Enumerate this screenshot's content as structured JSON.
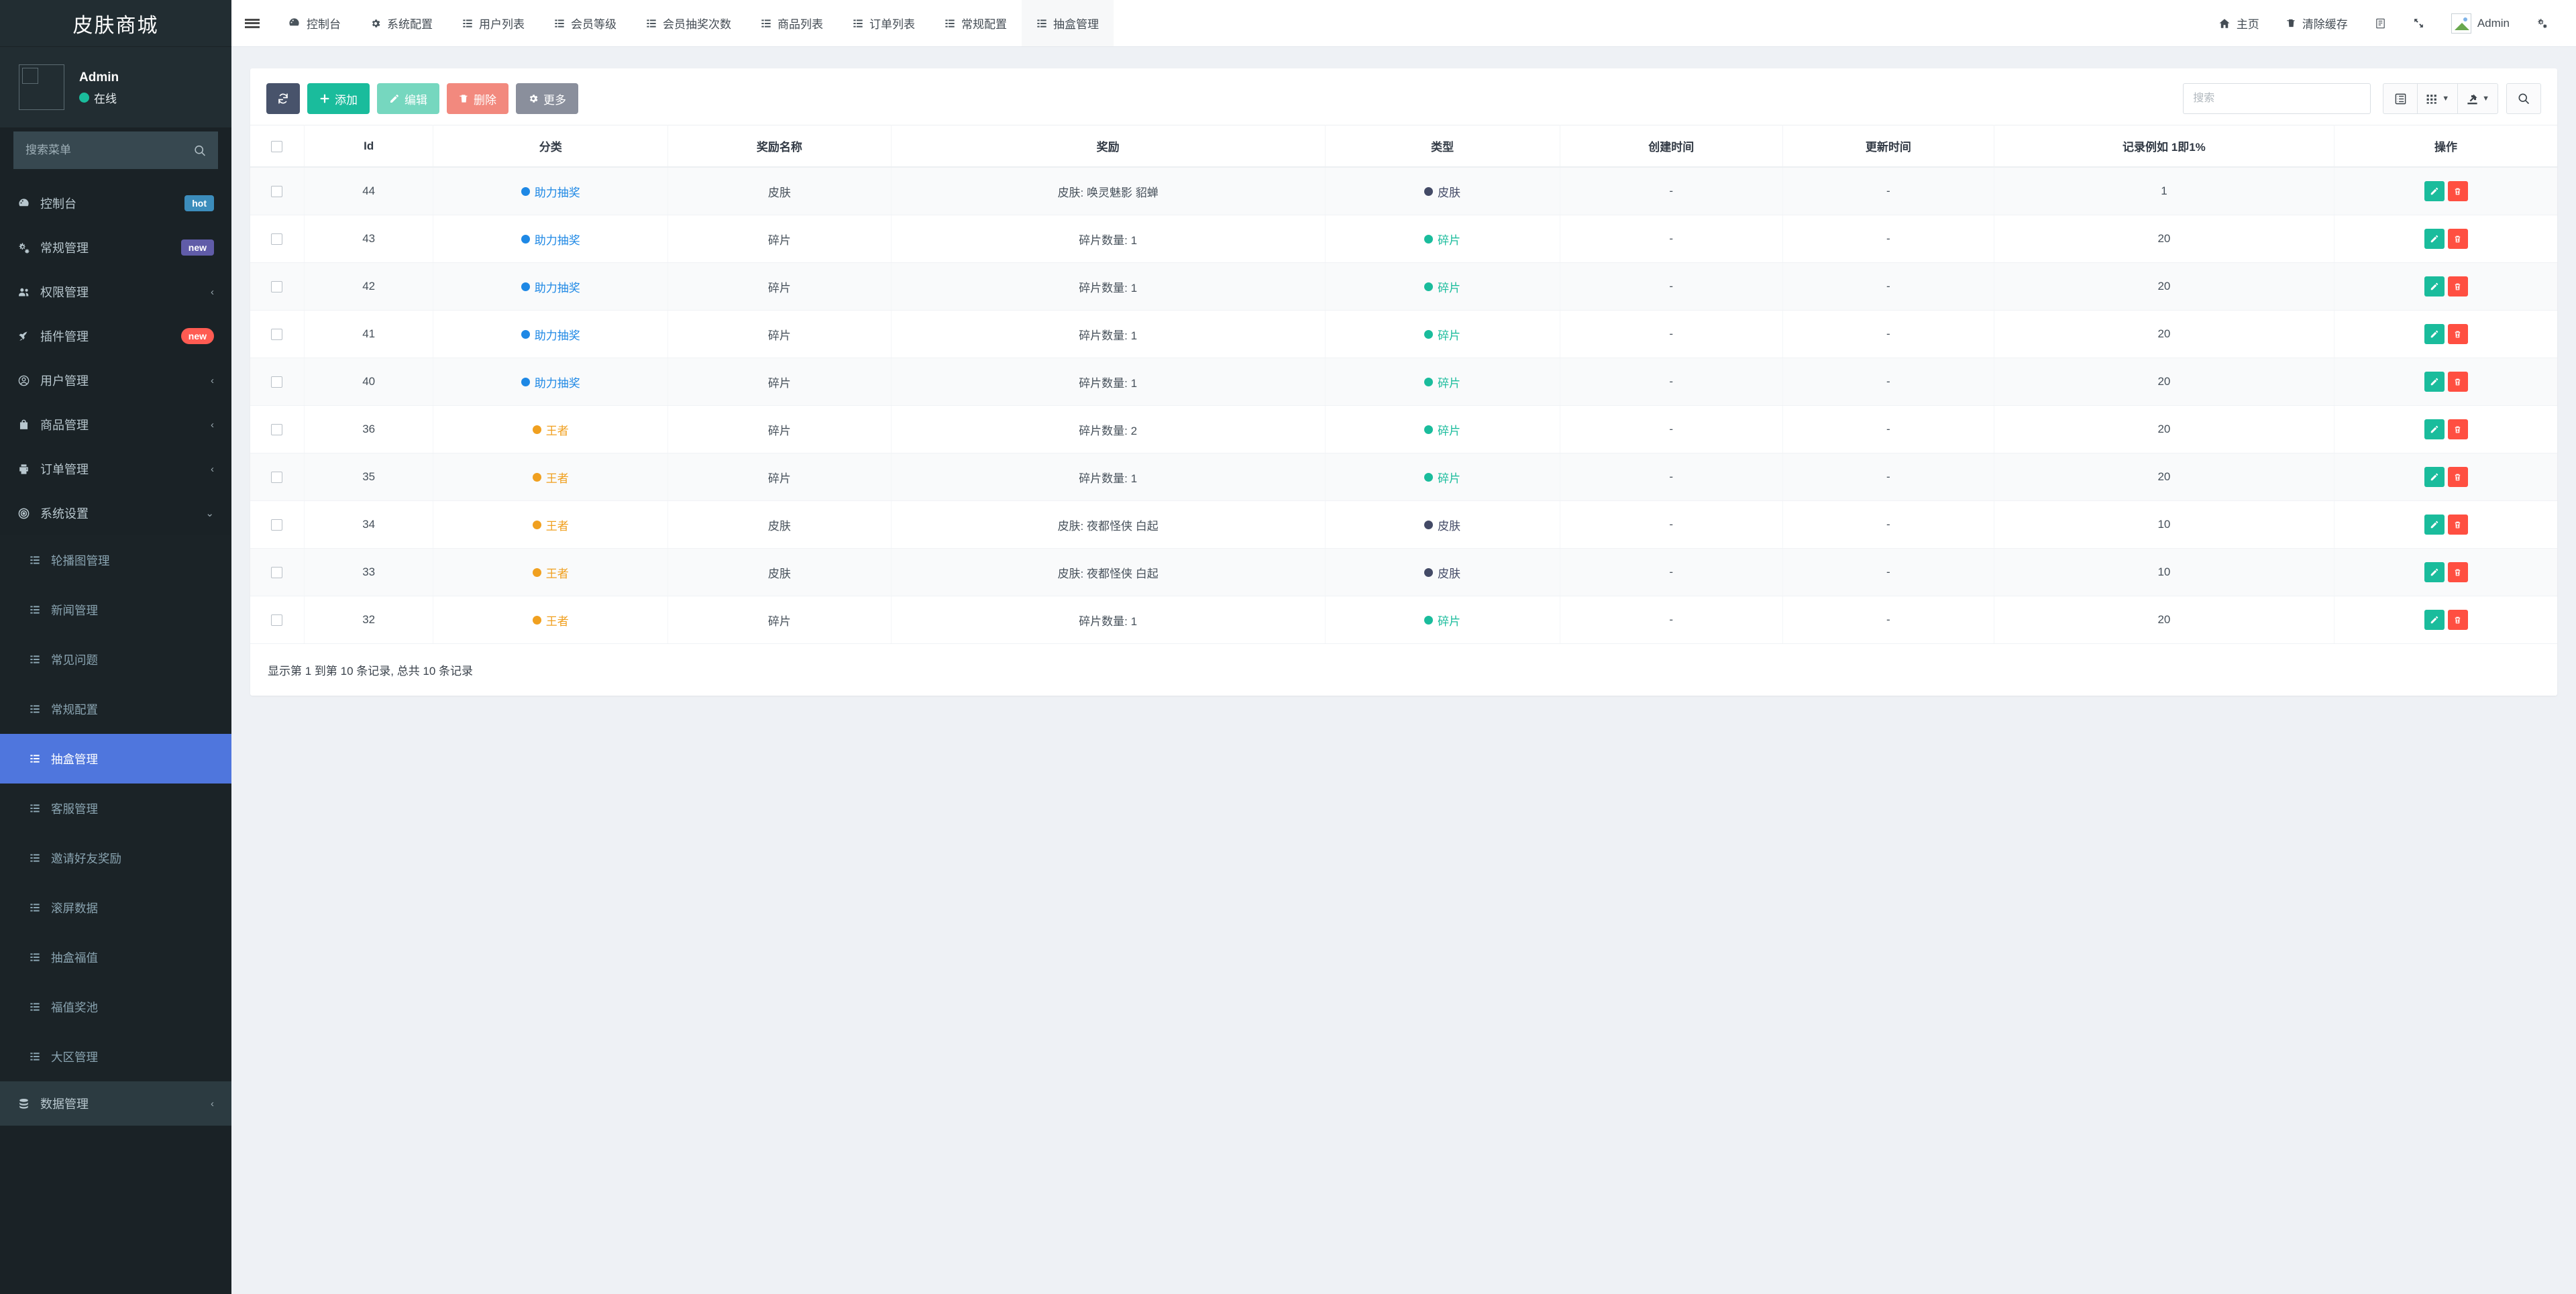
{
  "sidebar": {
    "brand": "皮肤商城",
    "user": {
      "name": "Admin",
      "status": "在线"
    },
    "search_placeholder": "搜索菜单",
    "menu": [
      {
        "label": "控制台",
        "icon": "dashboard-icon",
        "badge": "hot",
        "badge_style": "hot",
        "arrow": ""
      },
      {
        "label": "常规管理",
        "icon": "cogs-icon",
        "badge": "new",
        "badge_style": "new-purple",
        "arrow": ""
      },
      {
        "label": "权限管理",
        "icon": "users-icon",
        "badge": "",
        "badge_style": "",
        "arrow": "‹"
      },
      {
        "label": "插件管理",
        "icon": "rocket-icon",
        "badge": "new",
        "badge_style": "new-red",
        "arrow": ""
      },
      {
        "label": "用户管理",
        "icon": "user-circle-icon",
        "badge": "",
        "badge_style": "",
        "arrow": "‹"
      },
      {
        "label": "商品管理",
        "icon": "bag-icon",
        "badge": "",
        "badge_style": "",
        "arrow": "‹"
      },
      {
        "label": "订单管理",
        "icon": "printer-icon",
        "badge": "",
        "badge_style": "",
        "arrow": "‹"
      },
      {
        "label": "系统设置",
        "icon": "target-icon",
        "badge": "",
        "badge_style": "",
        "arrow": "⌄"
      }
    ],
    "submenu": [
      {
        "label": "轮播图管理",
        "active": false
      },
      {
        "label": "新闻管理",
        "active": false
      },
      {
        "label": "常见问题",
        "active": false
      },
      {
        "label": "常规配置",
        "active": false
      },
      {
        "label": "抽盒管理",
        "active": true
      },
      {
        "label": "客服管理",
        "active": false
      },
      {
        "label": "邀请好友奖励",
        "active": false
      },
      {
        "label": "滚屏数据",
        "active": false
      },
      {
        "label": "抽盒福值",
        "active": false
      },
      {
        "label": "福值奖池",
        "active": false
      },
      {
        "label": "大区管理",
        "active": false
      }
    ],
    "footer_menu": {
      "label": "数据管理",
      "icon": "database-icon",
      "arrow": "‹"
    }
  },
  "header": {
    "tabs": [
      {
        "label": "控制台",
        "icon": "dashboard-icon",
        "active": false
      },
      {
        "label": "系统配置",
        "icon": "gear-icon",
        "active": false
      },
      {
        "label": "用户列表",
        "icon": "list-icon",
        "active": false
      },
      {
        "label": "会员等级",
        "icon": "list-icon",
        "active": false
      },
      {
        "label": "会员抽奖次数",
        "icon": "list-icon",
        "active": false
      },
      {
        "label": "商品列表",
        "icon": "list-icon",
        "active": false
      },
      {
        "label": "订单列表",
        "icon": "list-icon",
        "active": false
      },
      {
        "label": "常规配置",
        "icon": "list-icon",
        "active": false
      },
      {
        "label": "抽盒管理",
        "icon": "list-icon",
        "active": true
      }
    ],
    "right": [
      {
        "label": "主页",
        "icon": "home-icon"
      },
      {
        "label": "清除缓存",
        "icon": "trash-icon"
      },
      {
        "label": "",
        "icon": "language-icon"
      },
      {
        "label": "",
        "icon": "fullscreen-icon"
      },
      {
        "label": "Admin",
        "icon": "avatar-icon"
      },
      {
        "label": "",
        "icon": "settings-gear-icon"
      }
    ]
  },
  "toolbar": {
    "refresh_label": "",
    "add_label": "添加",
    "edit_label": "编辑",
    "delete_label": "删除",
    "more_label": "更多",
    "search_placeholder": "搜索",
    "tool_buttons": [
      {
        "icon": "columns-icon",
        "caret": false
      },
      {
        "icon": "grid-icon",
        "caret": true
      },
      {
        "icon": "export-icon",
        "caret": true
      }
    ],
    "search_button_icon": "search-icon"
  },
  "table": {
    "columns": [
      "",
      "Id",
      "分类",
      "奖励名称",
      "奖励",
      "类型",
      "创建时间",
      "更新时间",
      "记录例如 1即1%",
      "操作"
    ],
    "action_labels": {
      "edit": "edit-icon",
      "delete": "delete-icon"
    },
    "rows": [
      {
        "id": "44",
        "category": "助力抽奖",
        "category_color": "#1e88e5",
        "reward_name": "皮肤",
        "reward": "皮肤: 唤灵魅影 貂蝉",
        "type": "皮肤",
        "type_color": "#434a66",
        "created": "-",
        "updated": "-",
        "ratio": "1"
      },
      {
        "id": "43",
        "category": "助力抽奖",
        "category_color": "#1e88e5",
        "reward_name": "碎片",
        "reward": "碎片数量: 1",
        "type": "碎片",
        "type_color": "#1abc9c",
        "created": "-",
        "updated": "-",
        "ratio": "20"
      },
      {
        "id": "42",
        "category": "助力抽奖",
        "category_color": "#1e88e5",
        "reward_name": "碎片",
        "reward": "碎片数量: 1",
        "type": "碎片",
        "type_color": "#1abc9c",
        "created": "-",
        "updated": "-",
        "ratio": "20"
      },
      {
        "id": "41",
        "category": "助力抽奖",
        "category_color": "#1e88e5",
        "reward_name": "碎片",
        "reward": "碎片数量: 1",
        "type": "碎片",
        "type_color": "#1abc9c",
        "created": "-",
        "updated": "-",
        "ratio": "20"
      },
      {
        "id": "40",
        "category": "助力抽奖",
        "category_color": "#1e88e5",
        "reward_name": "碎片",
        "reward": "碎片数量: 1",
        "type": "碎片",
        "type_color": "#1abc9c",
        "created": "-",
        "updated": "-",
        "ratio": "20"
      },
      {
        "id": "36",
        "category": "王者",
        "category_color": "#f0a020",
        "reward_name": "碎片",
        "reward": "碎片数量: 2",
        "type": "碎片",
        "type_color": "#1abc9c",
        "created": "-",
        "updated": "-",
        "ratio": "20"
      },
      {
        "id": "35",
        "category": "王者",
        "category_color": "#f0a020",
        "reward_name": "碎片",
        "reward": "碎片数量: 1",
        "type": "碎片",
        "type_color": "#1abc9c",
        "created": "-",
        "updated": "-",
        "ratio": "20"
      },
      {
        "id": "34",
        "category": "王者",
        "category_color": "#f0a020",
        "reward_name": "皮肤",
        "reward": "皮肤: 夜都怪侠 白起",
        "type": "皮肤",
        "type_color": "#434a66",
        "created": "-",
        "updated": "-",
        "ratio": "10"
      },
      {
        "id": "33",
        "category": "王者",
        "category_color": "#f0a020",
        "reward_name": "皮肤",
        "reward": "皮肤: 夜都怪侠 白起",
        "type": "皮肤",
        "type_color": "#434a66",
        "created": "-",
        "updated": "-",
        "ratio": "10"
      },
      {
        "id": "32",
        "category": "王者",
        "category_color": "#f0a020",
        "reward_name": "碎片",
        "reward": "碎片数量: 1",
        "type": "碎片",
        "type_color": "#1abc9c",
        "created": "-",
        "updated": "-",
        "ratio": "20"
      }
    ],
    "footer": "显示第 1 到第 10 条记录, 总共 10 条记录"
  },
  "colors": {
    "sidebar_bg": "#1a2226",
    "sidebar_header_bg": "#222d32",
    "active_menu": "#4f76dd",
    "accent_teal": "#1abc9c",
    "accent_red": "#ff4f41",
    "content_bg": "#eef1f5"
  }
}
